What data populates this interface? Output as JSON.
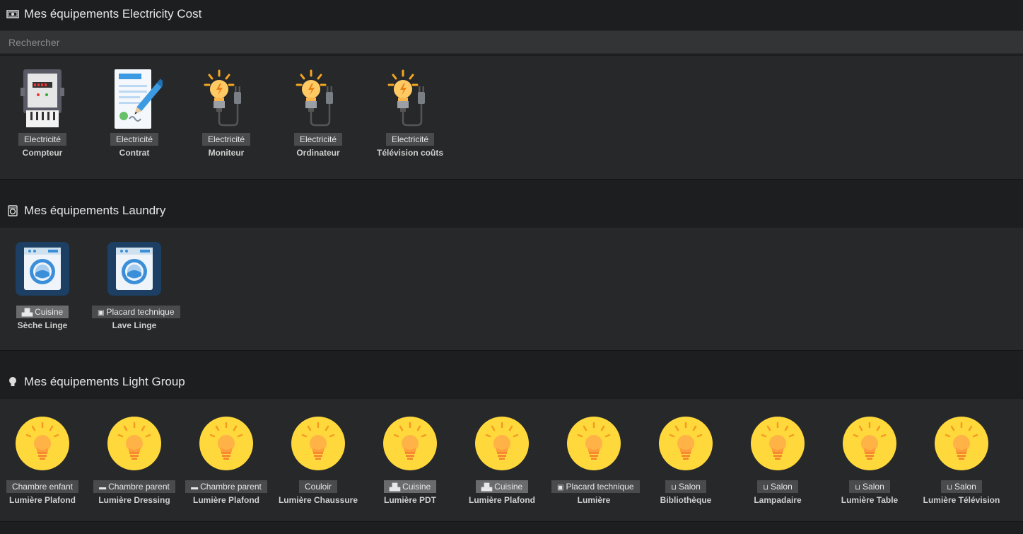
{
  "sections": [
    {
      "title": "Mes équipements Electricity Cost",
      "icon": "money-icon"
    },
    {
      "title": "Mes équipements Laundry",
      "icon": "washing-machine-icon"
    },
    {
      "title": "Mes équipements Light Group",
      "icon": "lightbulb-icon"
    }
  ],
  "search": {
    "placeholder": "Rechercher"
  },
  "electricity": [
    {
      "tag": "Electricité",
      "name": "Compteur",
      "icon": "electric-meter-icon"
    },
    {
      "tag": "Electricité",
      "name": "Contrat",
      "icon": "contract-icon"
    },
    {
      "tag": "Electricité",
      "name": "Moniteur",
      "icon": "bulb-plug-icon"
    },
    {
      "tag": "Electricité",
      "name": "Ordinateur",
      "icon": "bulb-plug-icon"
    },
    {
      "tag": "Electricité",
      "name": "Télévision coûts",
      "icon": "bulb-plug-icon"
    }
  ],
  "laundry": [
    {
      "tag": "Cuisine",
      "tag_icon": "kitchen-icon",
      "name": "Sèche Linge",
      "icon": "washing-machine-icon"
    },
    {
      "tag": "Placard technique",
      "tag_icon": "cabinet-icon",
      "name": "Lave Linge",
      "icon": "washing-machine-icon"
    }
  ],
  "lights": [
    {
      "tag": "Chambre enfant",
      "tag_icon": "",
      "name": "Lumière Plafond"
    },
    {
      "tag": "Chambre parent",
      "tag_icon": "bed-icon",
      "name": "Lumière Dressing"
    },
    {
      "tag": "Chambre parent",
      "tag_icon": "bed-icon",
      "name": "Lumière Plafond"
    },
    {
      "tag": "Couloir",
      "tag_icon": "",
      "name": "Lumière Chaussure"
    },
    {
      "tag": "Cuisine",
      "tag_icon": "kitchen-icon",
      "name": "Lumière PDT"
    },
    {
      "tag": "Cuisine",
      "tag_icon": "kitchen-icon",
      "name": "Lumière Plafond"
    },
    {
      "tag": "Placard technique",
      "tag_icon": "cabinet-icon",
      "name": "Lumière"
    },
    {
      "tag": "Salon",
      "tag_icon": "sofa-icon",
      "name": "Bibliothèque"
    },
    {
      "tag": "Salon",
      "tag_icon": "sofa-icon",
      "name": "Lampadaire"
    },
    {
      "tag": "Salon",
      "tag_icon": "sofa-icon",
      "name": "Lumière Table"
    },
    {
      "tag": "Salon",
      "tag_icon": "sofa-icon",
      "name": "Lumière Télévision"
    }
  ],
  "colors": {
    "background": "#1d1e1f",
    "panel": "#272829",
    "tag": "#4a4b4d",
    "bulb": "#ffd83b"
  }
}
